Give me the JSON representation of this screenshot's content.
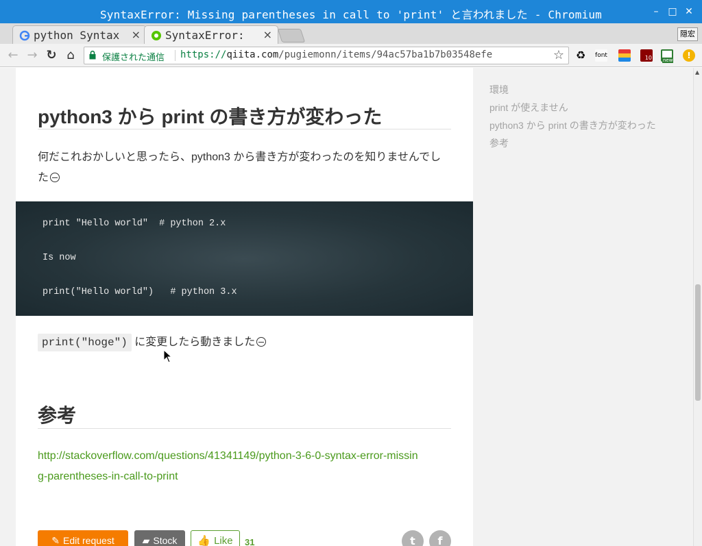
{
  "window": {
    "title": "SyntaxError: Missing parentheses in call to 'print' と言われました - Chromium",
    "min_glyph": "–",
    "max_glyph": "□",
    "close_glyph": "✕"
  },
  "tabs": [
    {
      "label": "python Syntax",
      "close": "×",
      "active": false
    },
    {
      "label": "SyntaxError: ",
      "close": "×",
      "active": true
    }
  ],
  "ime": {
    "label": "隠宏"
  },
  "toolbar": {
    "back": "←",
    "forward": "→",
    "reload": "↻",
    "home": "⌂",
    "secure_label": "保護された通信",
    "url_scheme": "https://",
    "url_host": "qiita.com",
    "url_path": "/pugiemonn/items/94ac57ba1b7b03548efe",
    "star": "☆",
    "extensions": [
      {
        "name": "recycle-extension-icon",
        "label": "♻",
        "color": "#555555"
      },
      {
        "name": "font-extension-icon",
        "label": "font",
        "color": "#888888"
      },
      {
        "name": "palette-extension-icon",
        "label": "",
        "color": "#e53935"
      },
      {
        "name": "ublock-extension-icon",
        "label": "10",
        "color": "#8b0000"
      },
      {
        "name": "new-extension-icon",
        "label": "new",
        "color": "#2e7d32"
      },
      {
        "name": "warning-extension-icon",
        "label": "!",
        "color": "#f4b400"
      }
    ]
  },
  "sidebar": {
    "toc": [
      "環境",
      "print が使えません",
      "python3 から print の書き方が変わった",
      "参考"
    ]
  },
  "article": {
    "section1_heading": "python3 から print の書き方が変わった",
    "para1": "何だこれおかしいと思ったら、python3 から書き方が変わったのを知りませんでした",
    "code_lines": [
      "print \"Hello world\"  # python 2.x",
      "Is now",
      "print(\"Hello world\")   # python 3.x"
    ],
    "inline_code": "print(\"hoge\")",
    "para2_text": " に変更したら動きました",
    "section2_heading": "参考",
    "link_line1": "http://stackoverflow.com/questions/41341149/python-3-6-0-syntax-error-missin",
    "link_line2": "g-parentheses-in-call-to-print",
    "edit_request_label": "Edit request",
    "stock_label": "Stock",
    "like_label": "Like",
    "like_count": "31",
    "twitter_glyph": "t",
    "facebook_glyph": "f"
  },
  "colors": {
    "titlebar": "#1e86d8",
    "link": "#4a9a1c",
    "edit_request": "#f57c00",
    "stock": "#6b6b6b",
    "like": "#5a9e2f"
  }
}
